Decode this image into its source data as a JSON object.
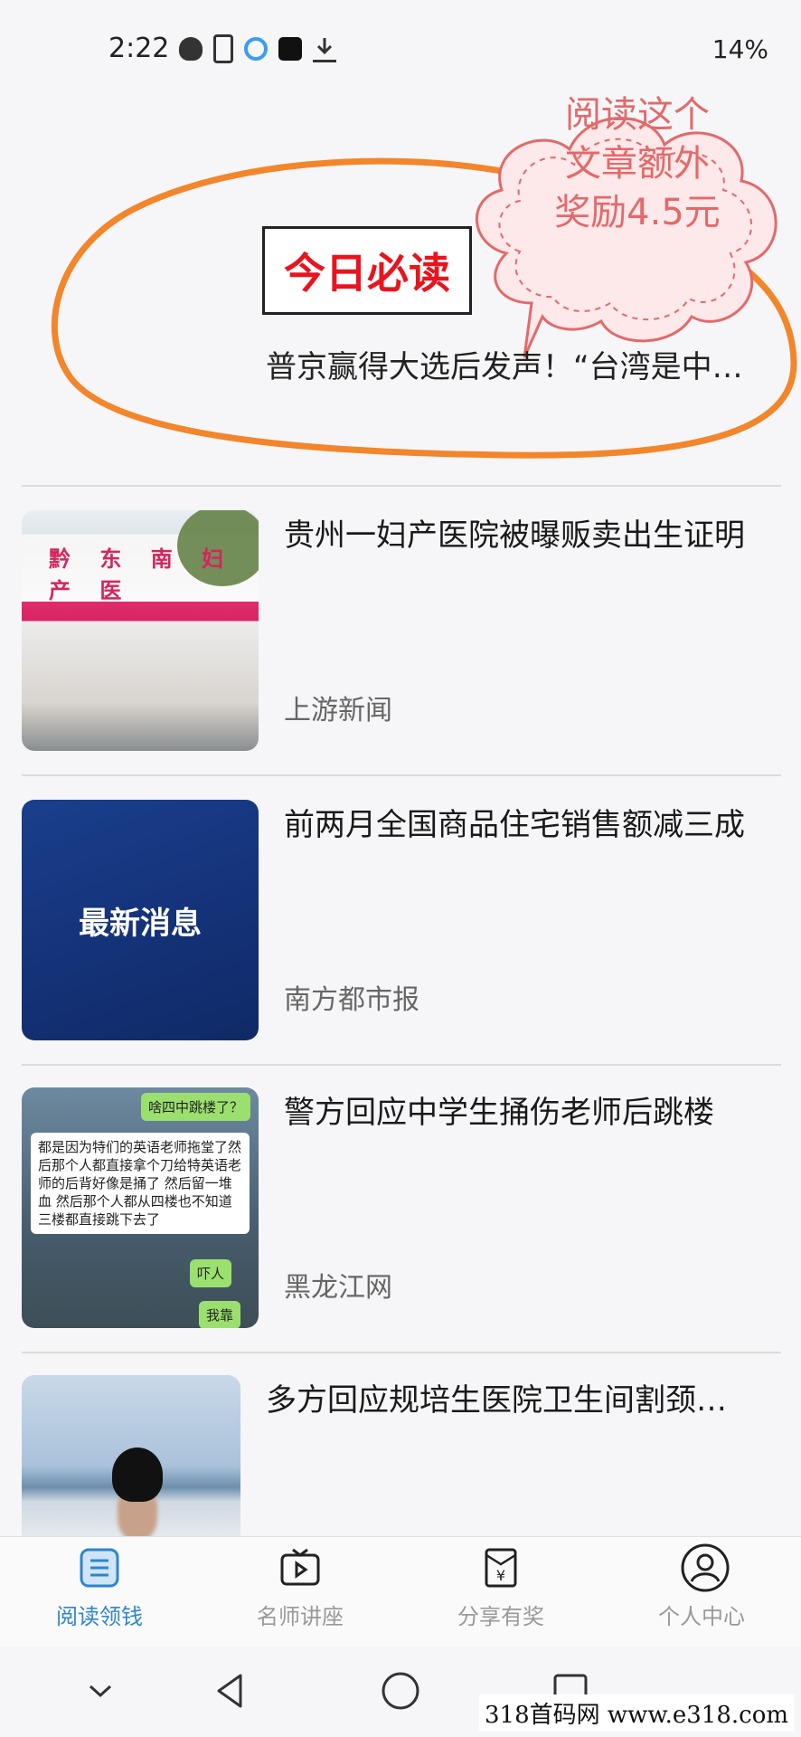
{
  "status_bar": {
    "time": "2:22",
    "battery": "14%"
  },
  "banner": {
    "badge": "今日必读",
    "headline": "普京赢得大选后发声！“台湾是中…",
    "bonus_lines": [
      "阅读这个",
      "文章额外",
      "奖励4.5元"
    ]
  },
  "news": [
    {
      "title": "贵州一妇产医院被曝贩卖出生证明",
      "source": "上游新闻",
      "thumb_text": "黔 东 南 妇 产 医"
    },
    {
      "title": "前两月全国商品住宅销售额减三成",
      "source": "南方都市报",
      "thumb_text": "最新消息"
    },
    {
      "title": "警方回应中学生捅伤老师后跳楼",
      "source": "黑龙江网",
      "chat": {
        "top": "啥四中跳楼了？",
        "message": "都是因为特们的英语老师拖堂了然后那个人都直接拿个刀给特英语老师的后背好像是捅了 然后留一堆血 然后那个人都从四楼也不知道三楼都直接跳下去了",
        "reply1": "吓人",
        "reply2": "我靠"
      }
    },
    {
      "title": "多方回应规培生医院卫生间割颈…",
      "source": ""
    }
  ],
  "bottom_nav": [
    {
      "label": "阅读领钱",
      "icon": "list-icon",
      "active": true
    },
    {
      "label": "名师讲座",
      "icon": "tv-icon",
      "active": false
    },
    {
      "label": "分享有奖",
      "icon": "envelope-yuan-icon",
      "active": false
    },
    {
      "label": "个人中心",
      "icon": "person-icon",
      "active": false
    }
  ],
  "watermark": "318首码网 www.e318.com",
  "colors": {
    "accent": "#2f86c9",
    "badge_red": "#e8141e",
    "outline_orange": "#f3852a",
    "bubble_pink": "#e26a6a"
  }
}
